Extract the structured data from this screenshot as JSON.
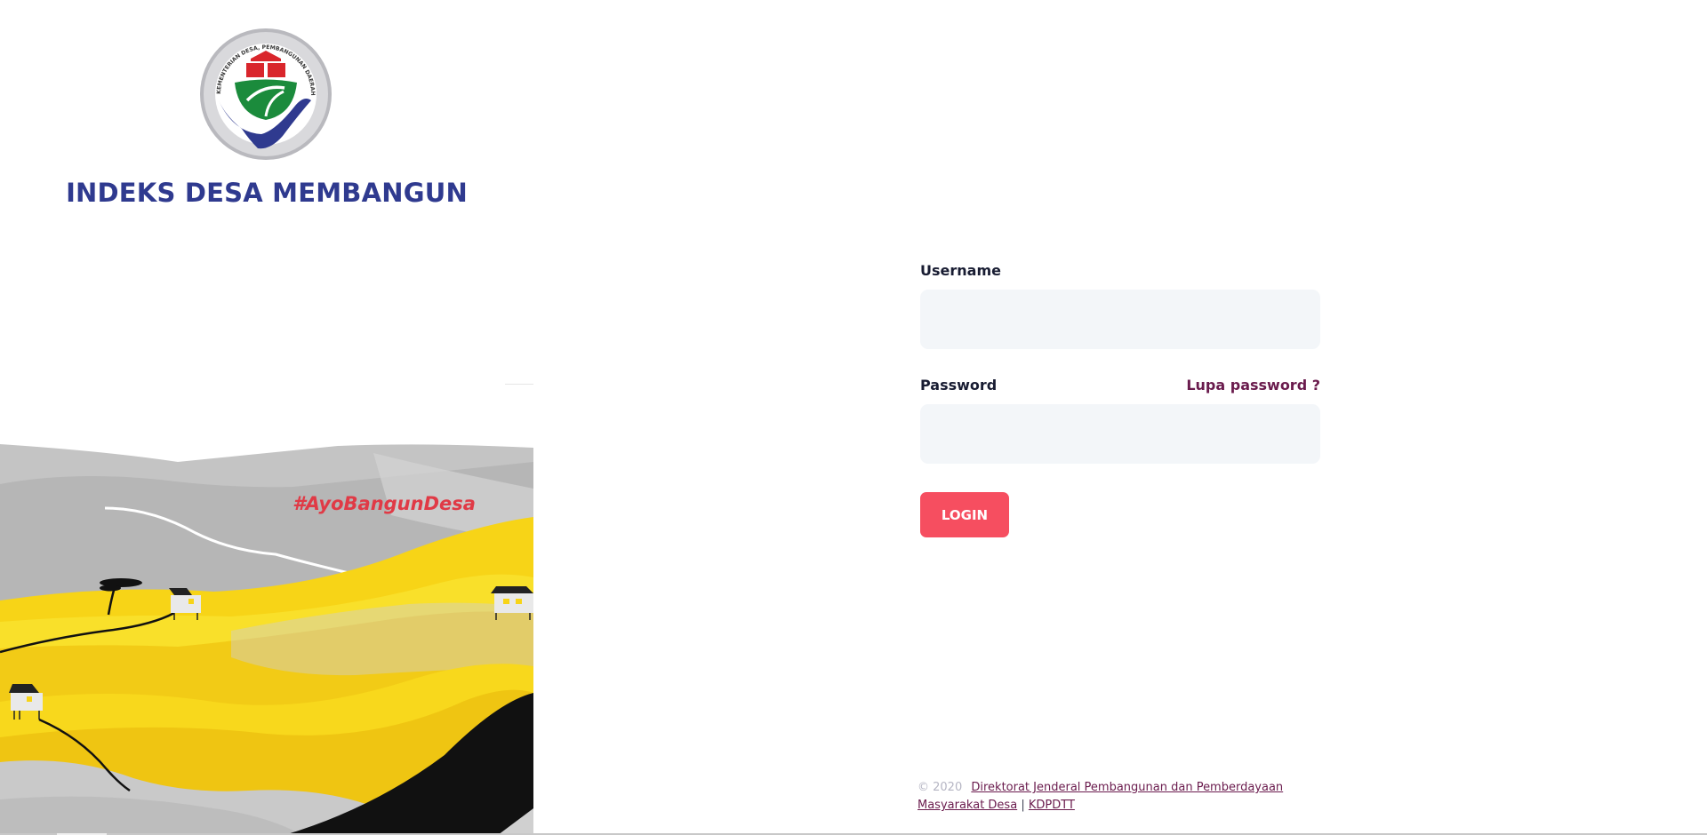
{
  "brand": {
    "title": "INDEKS DESA MEMBANGUN",
    "logo_text": "KEMENTERIAN DESA, PEMBANGUNAN DAERAH TERTINGGAL, DAN TRANSMIGRASI"
  },
  "illustration": {
    "hashtag": "#AyoBangunDesa"
  },
  "login": {
    "username_label": "Username",
    "username_value": "",
    "password_label": "Password",
    "password_value": "",
    "forgot_label": "Lupa password ?",
    "submit_label": "LOGIN"
  },
  "footer": {
    "copyright": "© 2020",
    "org_link": "Direktorat Jenderal Pembangunan dan Pemberdayaan Masyarakat Desa",
    "separator": "|",
    "kdpdtt_link": "KDPDTT"
  },
  "colors": {
    "brand_blue": "#2f3a8f",
    "accent_red": "#f64e60",
    "link_purple": "#6a1b4d",
    "input_bg": "#f3f6f9",
    "illustration_yellow": "#f7d417",
    "illustration_gray": "#bdbdbd"
  },
  "icons": {
    "logo": "ministry-seal-icon"
  }
}
